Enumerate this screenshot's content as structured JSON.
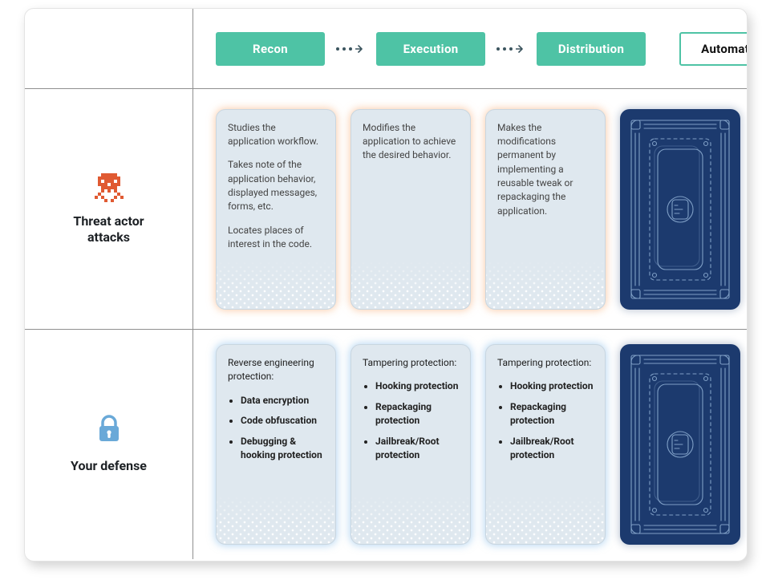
{
  "stages": {
    "recon": "Recon",
    "execution": "Execution",
    "distribution": "Distribution",
    "automation": "Automation"
  },
  "rows": {
    "threat_label": "Threat actor attacks",
    "defense_label": "Your defense"
  },
  "threat": {
    "recon": {
      "p1": "Studies the application workflow.",
      "p2": "Takes note of the application behavior, displayed messages, forms, etc.",
      "p3": "Locates places of interest in the code."
    },
    "execution": {
      "p1": "Modifies the application to achieve the desired behavior."
    },
    "distribution": {
      "p1": "Makes the modifications permanent by implementing a reusable tweak or repackaging the application."
    }
  },
  "defense": {
    "recon": {
      "title": "Reverse engineering protection:",
      "items": [
        "Data encryption",
        "Code obfuscation",
        "Debugging & hooking protection"
      ]
    },
    "execution": {
      "title": "Tampering protection:",
      "items": [
        "Hooking protection",
        "Repackaging protection",
        "Jailbreak/Root protection"
      ]
    },
    "distribution": {
      "title": "Tampering protection:",
      "items": [
        "Hooking protection",
        "Repackaging protection",
        "Jailbreak/Root protection"
      ]
    }
  }
}
